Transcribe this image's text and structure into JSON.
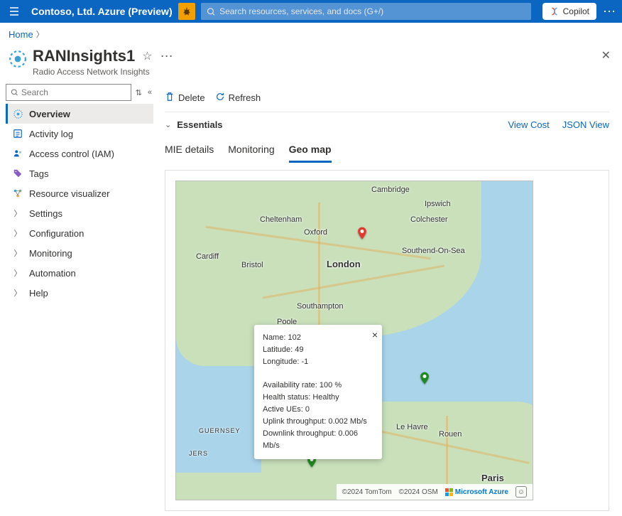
{
  "topbar": {
    "portal_title": "Contoso, Ltd. Azure (Preview)",
    "search_placeholder": "Search resources, services, and docs (G+/)",
    "copilot_label": "Copilot"
  },
  "breadcrumb": {
    "home": "Home"
  },
  "resource": {
    "title": "RANInsights1",
    "subtitle": "Radio Access Network Insights"
  },
  "side_search_placeholder": "Search",
  "sidemenu": [
    {
      "icon": "overview",
      "label": "Overview",
      "active": true
    },
    {
      "icon": "log",
      "label": "Activity log"
    },
    {
      "icon": "iam",
      "label": "Access control (IAM)"
    },
    {
      "icon": "tags",
      "label": "Tags"
    },
    {
      "icon": "viz",
      "label": "Resource visualizer"
    },
    {
      "icon": "chev",
      "label": "Settings"
    },
    {
      "icon": "chev",
      "label": "Configuration"
    },
    {
      "icon": "chev",
      "label": "Monitoring"
    },
    {
      "icon": "chev",
      "label": "Automation"
    },
    {
      "icon": "chev",
      "label": "Help"
    }
  ],
  "cmdbar": {
    "delete": "Delete",
    "refresh": "Refresh"
  },
  "essentials": {
    "label": "Essentials",
    "view_cost": "View Cost",
    "json_view": "JSON View"
  },
  "tabs": [
    {
      "label": "MIE details",
      "active": false
    },
    {
      "label": "Monitoring",
      "active": false
    },
    {
      "label": "Geo map",
      "active": true
    }
  ],
  "map": {
    "cities": {
      "cambridge": "Cambridge",
      "ipswich": "Ipswich",
      "colchester": "Colchester",
      "cheltenham": "Cheltenham",
      "oxford": "Oxford",
      "southend": "Southend-On-Sea",
      "cardiff": "Cardiff",
      "bristol": "Bristol",
      "london": "London",
      "southampton": "Southampton",
      "poole": "Poole",
      "guernsey": "GUERNSEY",
      "jersey": "JERS",
      "lehavre": "Le Havre",
      "rouen": "Rouen",
      "paris": "Paris"
    },
    "attribution_tomtom": "©2024 TomTom",
    "attribution_osm": "©2024 OSM",
    "ms_label": "Microsoft Azure"
  },
  "popup": {
    "name_lbl": "Name:",
    "name_val": "102",
    "lat_lbl": "Latitude:",
    "lat_val": "49",
    "lon_lbl": "Longitude:",
    "lon_val": "-1",
    "avail_lbl": "Availability rate:",
    "avail_val": "100 %",
    "health_lbl": "Health status:",
    "health_val": "Healthy",
    "ues_lbl": "Active UEs:",
    "ues_val": "0",
    "up_lbl": "Uplink throughput:",
    "up_val": "0.002 Mb/s",
    "down_lbl": "Downlink throughput:",
    "down_val": "0.006 Mb/s"
  }
}
